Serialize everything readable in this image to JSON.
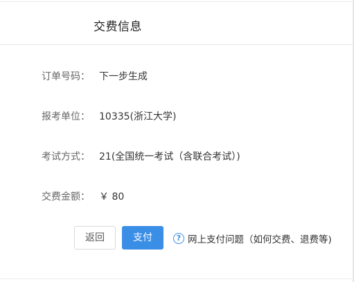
{
  "header": {
    "title": "交费信息"
  },
  "fields": {
    "order_number": {
      "label": "订单号码：",
      "value": "下一步生成"
    },
    "exam_unit": {
      "label": "报考单位：",
      "value": "10335(浙江大学)"
    },
    "exam_method": {
      "label": "考试方式：",
      "value": "21(全国统一考试（含联合考试）)"
    },
    "fee_amount": {
      "label": "交费金额：",
      "value": "￥ 80"
    }
  },
  "actions": {
    "back_label": "返回",
    "pay_label": "支付",
    "help_icon_glyph": "?",
    "help_link_text": "网上支付问题（如何交费、退费等)"
  },
  "colors": {
    "accent": "#3a8ee6"
  }
}
